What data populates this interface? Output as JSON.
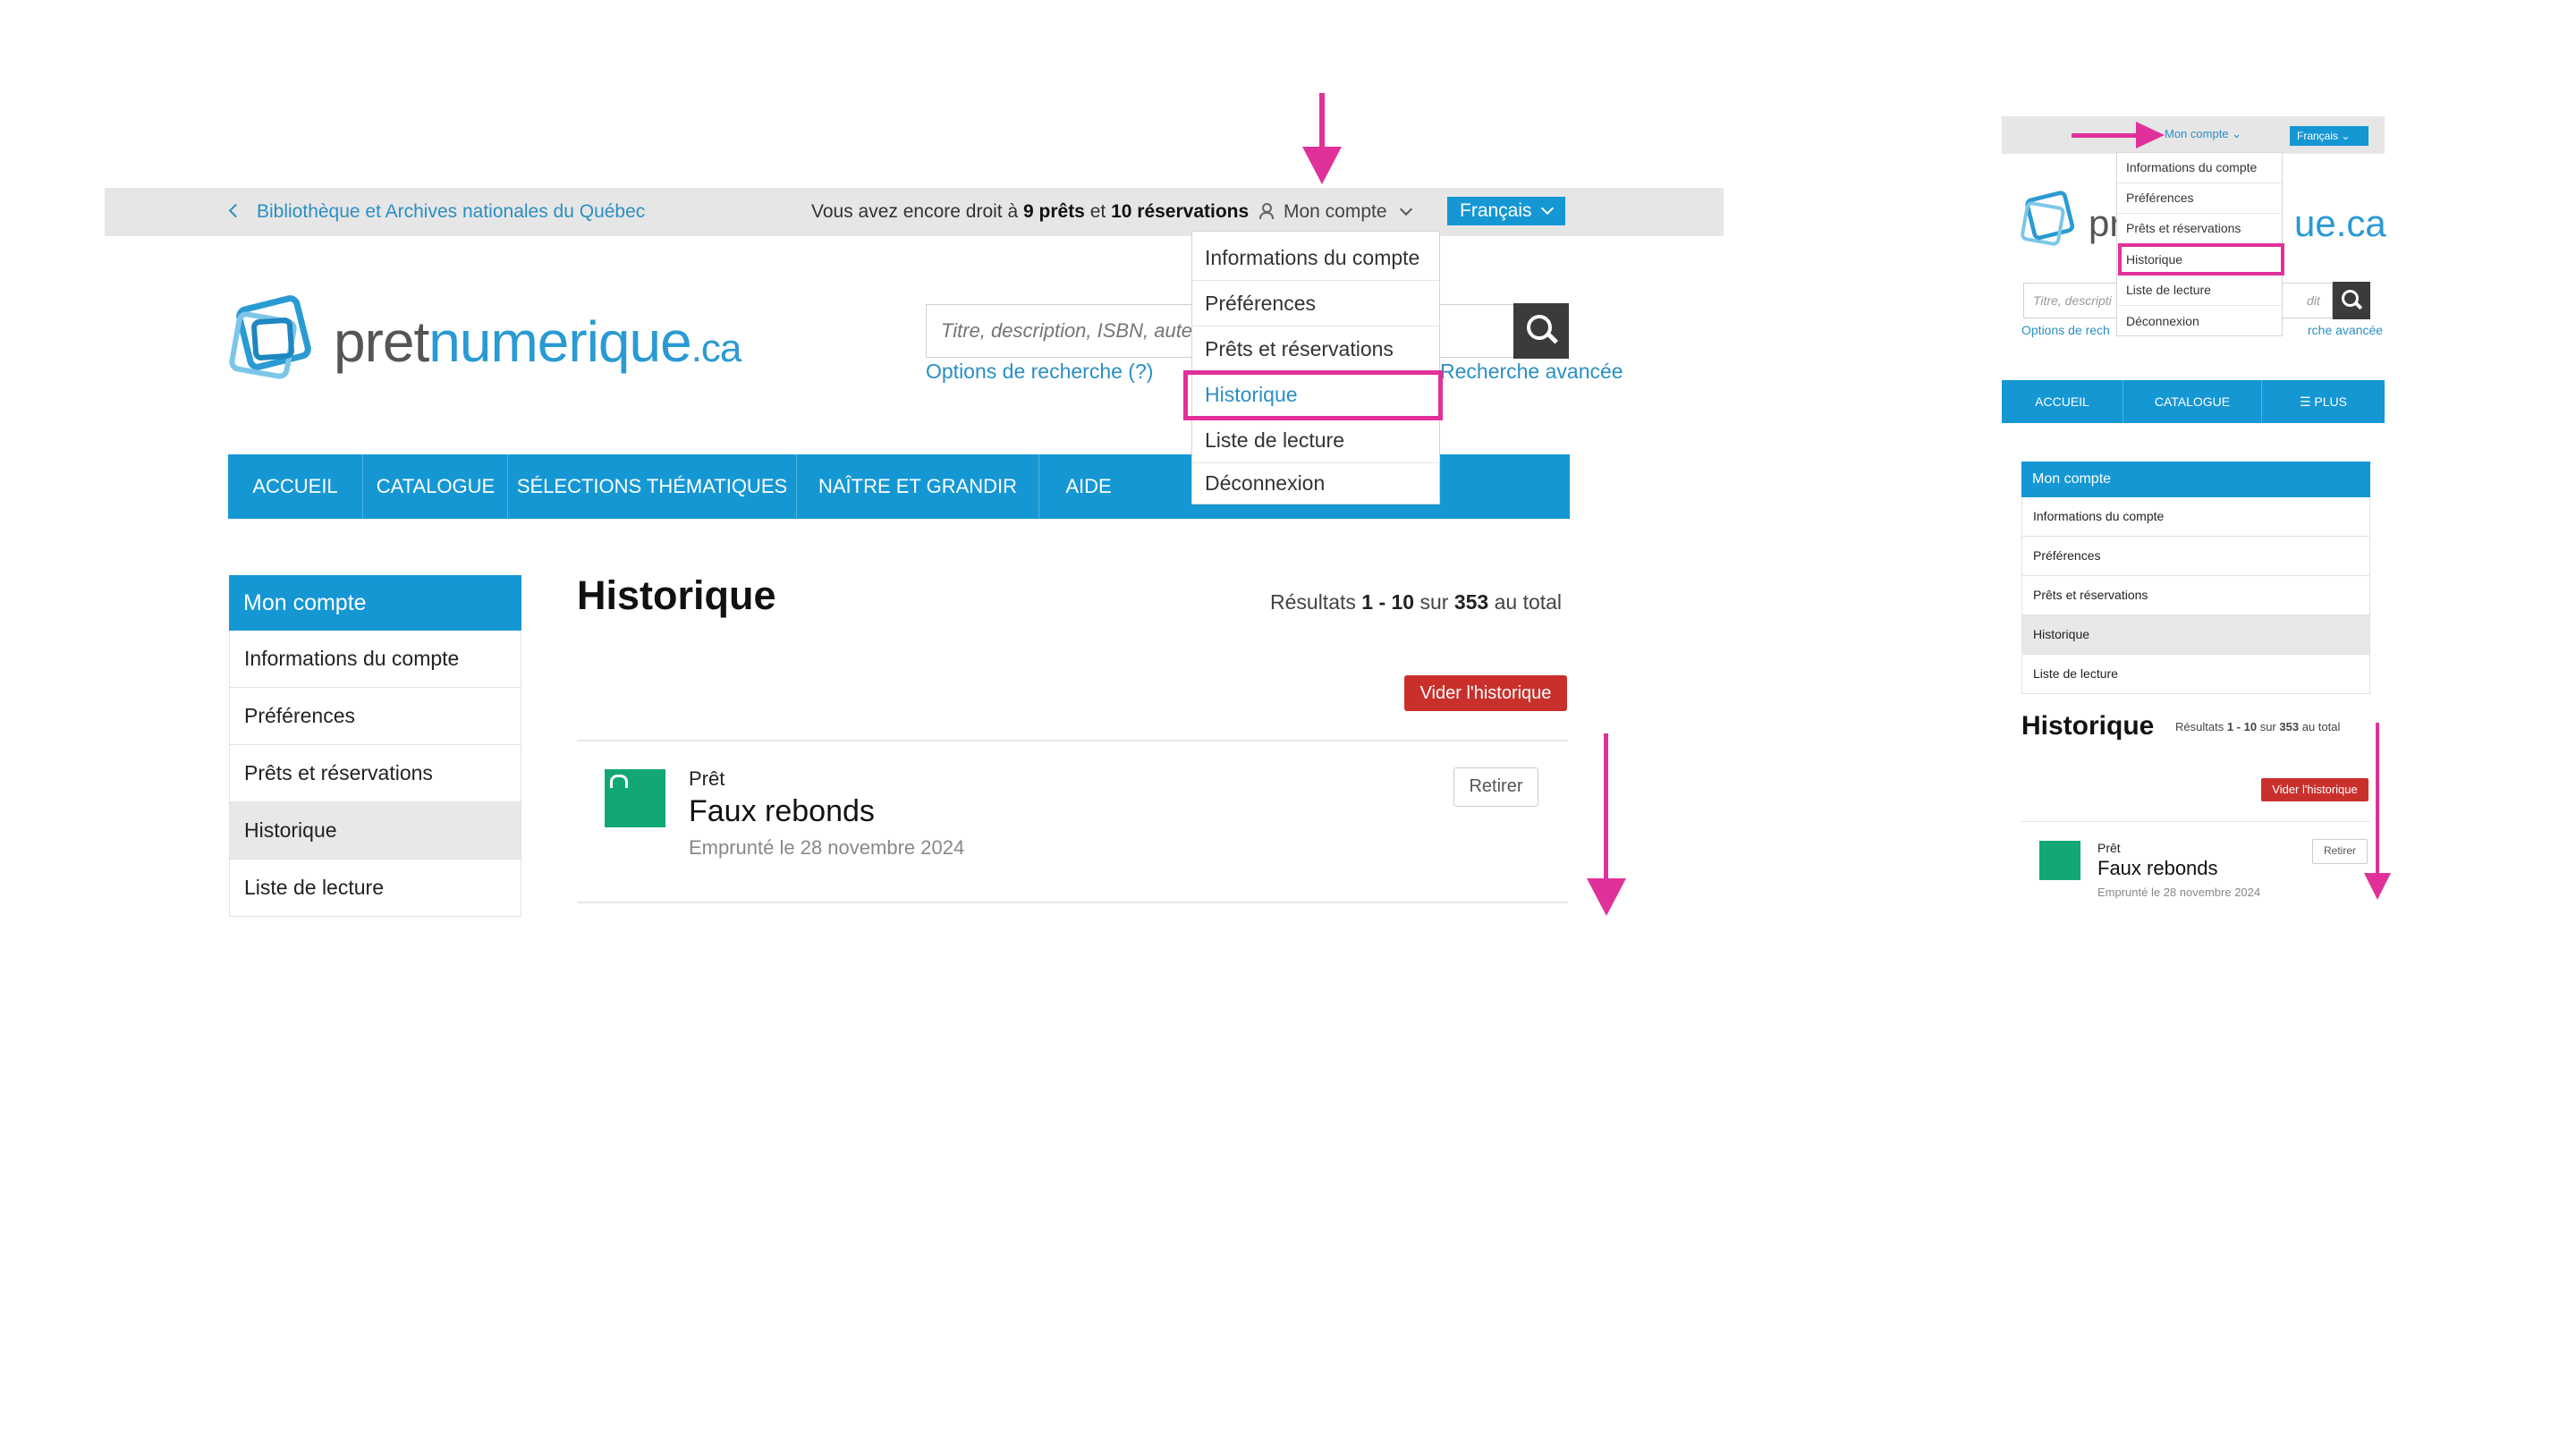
{
  "header": {
    "back_link": "Bibliothèque et Archives nationales du Québec",
    "quota_prefix": "Vous avez encore droit à",
    "quota_loans": "9 prêts",
    "quota_mid": "et",
    "quota_reservations": "10 réservations",
    "account_label": "Mon compte",
    "language": "Français"
  },
  "logo": {
    "part1": "pret",
    "part2": "numerique",
    "part3": ".ca"
  },
  "search": {
    "placeholder": "Titre, description, ISBN, auteur",
    "options_link": "Options de recherche (?)",
    "advanced_link": "Recherche avancée"
  },
  "nav": {
    "items": [
      "ACCUEIL",
      "CATALOGUE",
      "SÉLECTIONS THÉMATIQUES",
      "NAÎTRE ET GRANDIR",
      "AIDE"
    ]
  },
  "dropdown": {
    "items": [
      "Informations du compte",
      "Préférences",
      "Prêts et réservations",
      "Historique",
      "Liste de lecture",
      "Déconnexion"
    ],
    "highlighted": "Historique"
  },
  "sidebar": {
    "title": "Mon compte",
    "items": [
      "Informations du compte",
      "Préférences",
      "Prêts et réservations",
      "Historique",
      "Liste de lecture"
    ],
    "active": "Historique"
  },
  "main": {
    "title": "Historique",
    "results_prefix": "Résultats",
    "results_range": "1 - 10",
    "results_mid": "sur",
    "results_total": "353",
    "results_suffix": "au total",
    "clear_button": "Vider l'historique",
    "items": [
      {
        "type": "Prêt",
        "title": "Faux rebonds",
        "date": "Emprunté le 28 novembre 2024",
        "remove_label": "Retirer"
      }
    ]
  },
  "mobile": {
    "nav_items": [
      "ACCUEIL",
      "CATALOGUE",
      "☰ PLUS"
    ],
    "search_placeholder_left": "Titre, descripti",
    "search_placeholder_right": "dit",
    "options_link": "Options de rech",
    "advanced_link": "rche avancée",
    "logo_left": "pr",
    "logo_right": "ue.ca"
  },
  "colors": {
    "accent": "#1597d4",
    "link": "#2a8fc3",
    "danger": "#c9302c",
    "annotation": "#e0319a",
    "cover": "#12a776"
  }
}
